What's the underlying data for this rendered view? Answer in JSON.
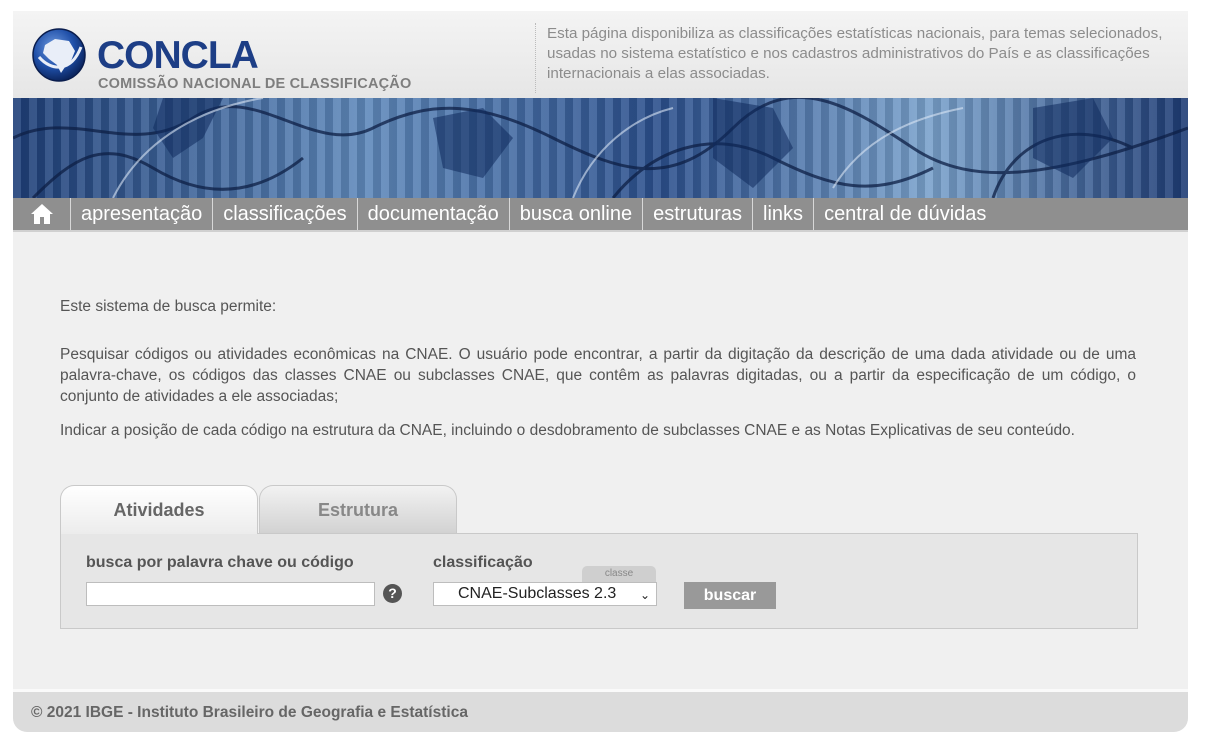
{
  "header": {
    "logo_title": "CONCLA",
    "logo_subtitle": "COMISSÃO NACIONAL DE CLASSIFICAÇÃO",
    "description": "Esta página disponibiliza as classificações estatísticas nacionais, para temas selecionados, usadas no sistema estatístico e nos cadastros administrativos do País e as classificações internacionais a elas associadas."
  },
  "nav": {
    "home_icon": "home-icon",
    "items": [
      "apresentação",
      "classificações",
      "documentação",
      "busca online",
      "estruturas",
      "links",
      "central de dúvidas"
    ]
  },
  "content": {
    "intro": "Este sistema de busca permite:",
    "para1": "Pesquisar códigos ou atividades econômicas na CNAE. O usuário pode encontrar, a partir da digitação da descrição de uma dada atividade ou de uma palavra-chave, os códigos das classes CNAE ou subclasses CNAE, que contêm as palavras digitadas, ou a partir da especificação de um código, o conjunto de atividades a ele associadas;",
    "para2": "Indicar a posição de cada código na estrutura da CNAE, incluindo o desdobramento de subclasses CNAE e as Notas Explicativas de seu conteúdo."
  },
  "search": {
    "tabs": [
      "Atividades",
      "Estrutura"
    ],
    "active_tab": "Atividades",
    "keyword_label": "busca por palavra chave ou código",
    "keyword_value": "",
    "help_icon": "help-icon",
    "help_glyph": "?",
    "class_label": "classificação",
    "classe_badge": "classe",
    "class_selected": "CNAE-Subclasses 2.3",
    "button_label": "buscar"
  },
  "footer": {
    "text": "© 2021 IBGE - Instituto Brasileiro de Geografia e Estatística"
  },
  "colors": {
    "nav_bg": "#8f8f8f",
    "logo_blue": "#1d3e86",
    "page_bg": "#f0f0f0",
    "button_bg": "#999999"
  }
}
